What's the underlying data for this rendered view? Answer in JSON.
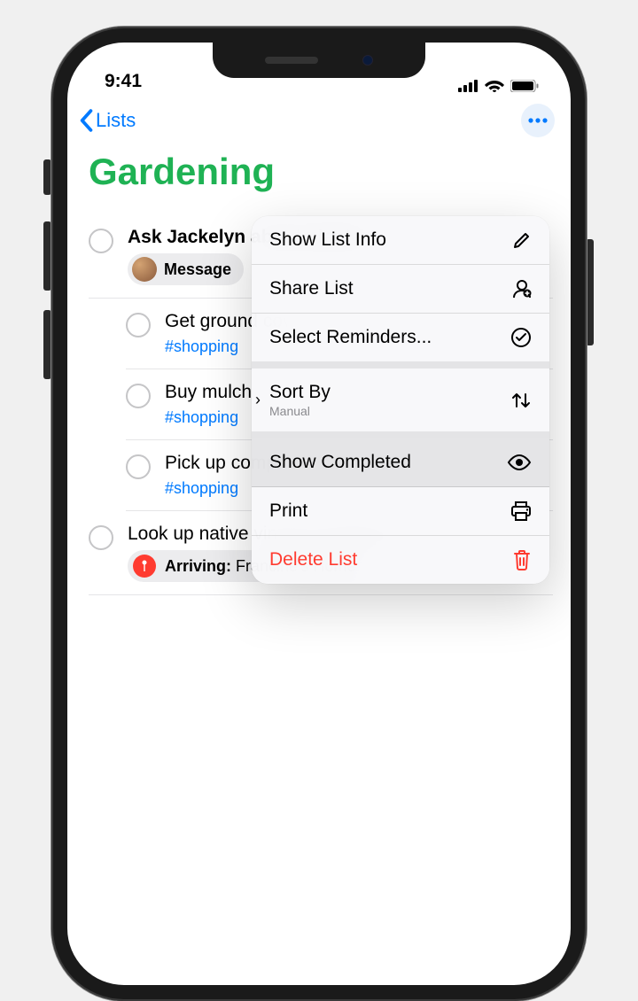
{
  "status": {
    "time": "9:41"
  },
  "nav": {
    "back_label": "Lists"
  },
  "list": {
    "title": "Gardening"
  },
  "reminders": [
    {
      "title": "Ask Jackelyn about planters",
      "chip_label": "Message"
    },
    {
      "title": "Get ground cover seeds",
      "tag": "#shopping"
    },
    {
      "title": "Buy mulch",
      "tag": "#shopping"
    },
    {
      "title": "Pick up compost",
      "tag": "#shopping"
    },
    {
      "title": "Look up native vines for along the fence",
      "location_label": "Arriving:",
      "location_value": " Francine's Home"
    }
  ],
  "menu": {
    "show_list_info": "Show List Info",
    "share_list": "Share List",
    "select_reminders": "Select Reminders...",
    "sort_by_label": "Sort By",
    "sort_by_value": "Manual",
    "show_completed": "Show Completed",
    "print": "Print",
    "delete_list": "Delete List"
  }
}
